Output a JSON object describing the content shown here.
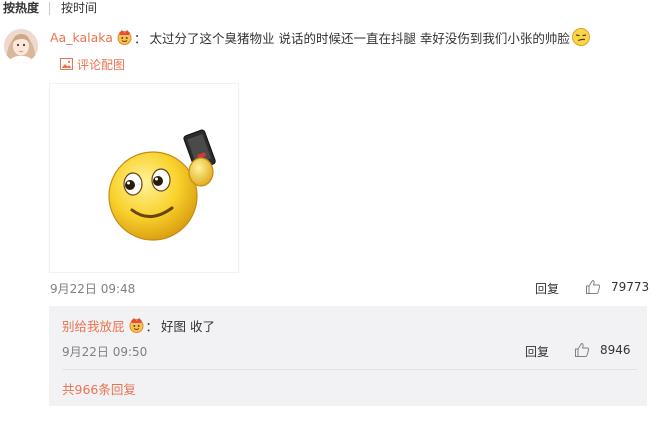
{
  "sort_tabs": {
    "hot": "按热度",
    "time": "按时间"
  },
  "comment": {
    "username": "Aa_kalaka",
    "colon": "：",
    "text": "太过分了这个臭猪物业 说话的时候还一直在抖腿 幸好没伤到我们小张的帅脸",
    "picture_link": "评论配图",
    "timestamp": "9月22日 09:48",
    "reply_label": "回复",
    "like_count": "79773"
  },
  "reply": {
    "username": "别给我放屁",
    "colon": "：",
    "text": "好图 收了",
    "timestamp": "9月22日 09:50",
    "reply_label": "回复",
    "like_count": "8946"
  },
  "more_replies": "共966条回复",
  "colors": {
    "accent": "#eb7350",
    "reply_bg": "#f2f2f5",
    "muted": "#808080"
  },
  "icons": {
    "vip_badge": "vip-badge-icon",
    "picture": "picture-icon",
    "like": "thumbs-up-icon",
    "emoji": "smirk-emoji-icon",
    "image_emoji": "smiley-with-phone-emoji"
  }
}
